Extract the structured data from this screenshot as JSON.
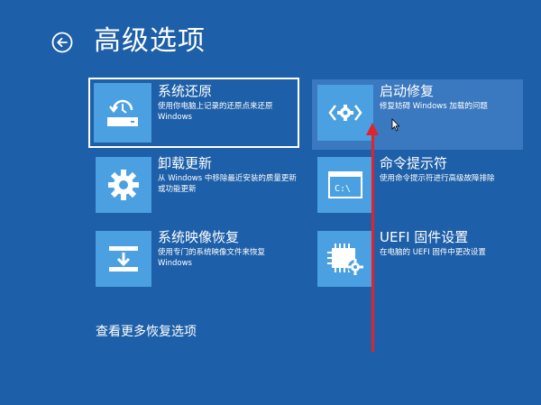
{
  "header": {
    "title": "高级选项",
    "back_icon": "back-arrow-icon"
  },
  "options": [
    {
      "title": "系统还原",
      "desc": "使用你电脑上记录的还原点来还原 Windows",
      "icon": "restore-icon",
      "state": "selected"
    },
    {
      "title": "卸载更新",
      "desc": "从 Windows 中移除最近安装的质量更新或功能更新",
      "icon": "gear-icon"
    },
    {
      "title": "系统映像恢复",
      "desc": "使用专门的系统映像文件来恢复 Windows",
      "icon": "image-recovery-icon"
    },
    {
      "title": "启动修复",
      "desc": "修复妨碍 Windows 加载的问题",
      "icon": "code-gear-icon",
      "state": "hover"
    },
    {
      "title": "命令提示符",
      "desc": "使用命令提示符进行高级故障排除",
      "icon": "command-prompt-icon",
      "prompt_text": "C:\\"
    },
    {
      "title": "UEFI 固件设置",
      "desc": "在电脑的 UEFI 固件中更改设置",
      "icon": "firmware-chip-icon"
    }
  ],
  "more_options_label": "查看更多恢复选项",
  "colors": {
    "background": "#1d5fa8",
    "tile_icon": "#4aa0e0",
    "hover": "#3a78c0",
    "annotation_arrow": "#e0242c"
  }
}
